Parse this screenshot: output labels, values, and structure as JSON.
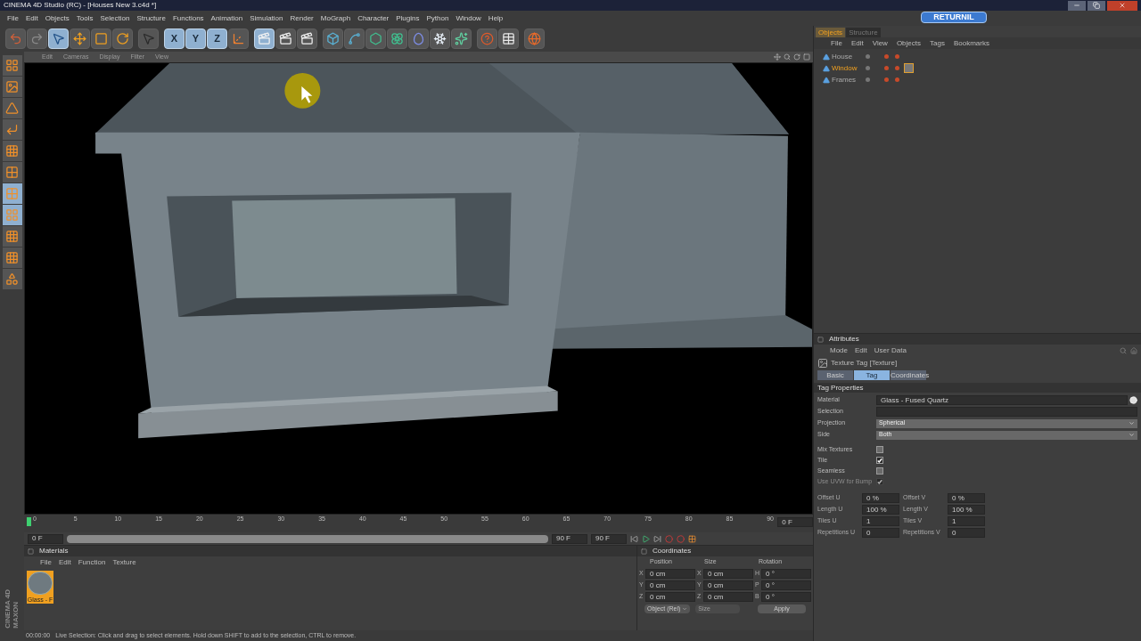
{
  "window": {
    "title": "CINEMA 4D Studio (RC) - [Houses New 3.c4d *]"
  },
  "menu": [
    "File",
    "Edit",
    "Objects",
    "Tools",
    "Selection",
    "Structure",
    "Functions",
    "Animation",
    "Simulation",
    "Render",
    "MoGraph",
    "Character",
    "Plugins",
    "Python",
    "Window",
    "Help"
  ],
  "badge": "RETURNIL",
  "toolbar": [
    [
      {
        "kind": "undo",
        "active": false
      },
      {
        "kind": "redo",
        "active": false
      },
      {
        "kind": "select",
        "active": true
      },
      {
        "kind": "move",
        "active": false
      },
      {
        "kind": "scale",
        "active": false
      },
      {
        "kind": "rotate",
        "active": false
      }
    ],
    [
      {
        "kind": "pointer",
        "active": false
      }
    ],
    [
      {
        "kind": "axis",
        "label": "X",
        "active": true
      },
      {
        "kind": "axis",
        "label": "Y",
        "active": true
      },
      {
        "kind": "axis",
        "label": "Z",
        "active": true
      },
      {
        "kind": "coords",
        "active": false
      }
    ],
    [
      {
        "kind": "render",
        "active": true
      },
      {
        "kind": "render",
        "active": false
      },
      {
        "kind": "render",
        "active": false
      }
    ],
    [
      {
        "kind": "cube",
        "active": false
      },
      {
        "kind": "spline",
        "active": false
      },
      {
        "kind": "nurbs",
        "active": false
      },
      {
        "kind": "array",
        "active": false
      },
      {
        "kind": "deformer",
        "active": false
      },
      {
        "kind": "scene",
        "active": false
      },
      {
        "kind": "particles",
        "active": false
      }
    ],
    [
      {
        "kind": "help",
        "active": false
      },
      {
        "kind": "table",
        "active": false
      }
    ],
    [
      {
        "kind": "globe",
        "active": false
      }
    ]
  ],
  "side_tools": [
    {
      "kind": "layout",
      "active": false
    },
    {
      "kind": "texture",
      "active": false
    },
    {
      "kind": "cone",
      "active": false
    },
    {
      "kind": "axis",
      "active": false
    },
    {
      "kind": "points",
      "active": false
    },
    {
      "kind": "edges",
      "active": false
    },
    {
      "kind": "polygons",
      "active": true
    },
    {
      "kind": "uv",
      "active": true
    },
    {
      "kind": "checker",
      "active": false
    },
    {
      "kind": "uvpoints",
      "active": false
    },
    {
      "kind": "shapes",
      "active": false
    }
  ],
  "logo": [
    "MAXON",
    "CINEMA 4D"
  ],
  "viewport": {
    "menu": [
      "Edit",
      "Cameras",
      "Display",
      "Filter",
      "View"
    ]
  },
  "timeline": {
    "ticks": [
      "0",
      "5",
      "10",
      "15",
      "20",
      "25",
      "30",
      "35",
      "40",
      "45",
      "50",
      "55",
      "60",
      "65",
      "70",
      "75",
      "80",
      "85",
      "90"
    ],
    "current": "0 F",
    "start": "0 F",
    "end": "90 F",
    "range_end": "90 F",
    "level": 1
  },
  "materials": {
    "title": "Materials",
    "menu": [
      "File",
      "Edit",
      "Function",
      "Texture"
    ],
    "items": [
      {
        "label": "Glass - F",
        "selected": true
      }
    ]
  },
  "coordinates": {
    "title": "Coordinates",
    "columns": [
      "Position",
      "Size",
      "Rotation"
    ],
    "rows": [
      [
        {
          "axis": "X",
          "value": "0 cm"
        },
        {
          "axis": "X",
          "value": "0 cm"
        },
        {
          "axis": "H",
          "value": "0 °"
        }
      ],
      [
        {
          "axis": "Y",
          "value": "0 cm"
        },
        {
          "axis": "Y",
          "value": "0 cm"
        },
        {
          "axis": "P",
          "value": "0 °"
        }
      ],
      [
        {
          "axis": "Z",
          "value": "0 cm"
        },
        {
          "axis": "Z",
          "value": "0 cm"
        },
        {
          "axis": "B",
          "value": "0 °"
        }
      ]
    ],
    "mode": "Object (Rel)",
    "size_mode": "Size",
    "apply": "Apply"
  },
  "status_bar": {
    "time": "00:00:00",
    "message": "Live Selection: Click and drag to select elements. Hold down SHIFT to add to the selection, CTRL to remove."
  },
  "objects_panel": {
    "tabs": [
      {
        "label": "Objects",
        "selected": true
      },
      {
        "label": "Structure",
        "selected": false
      }
    ],
    "menu": [
      "File",
      "Edit",
      "View",
      "Objects",
      "Tags",
      "Bookmarks"
    ],
    "items": [
      {
        "name": "House",
        "selected": false,
        "has_tag": false
      },
      {
        "name": "Window",
        "selected": true,
        "has_tag": true
      },
      {
        "name": "Frames",
        "selected": false,
        "has_tag": false
      }
    ]
  },
  "attributes": {
    "title": "Attributes",
    "menu": [
      "Mode",
      "Edit",
      "User Data"
    ],
    "object": "Texture Tag [Texture]",
    "tabs": [
      {
        "label": "Basic",
        "selected": false
      },
      {
        "label": "Tag",
        "selected": true
      },
      {
        "label": "Coordinates",
        "selected": false
      }
    ],
    "section": "Tag Properties",
    "fields": [
      {
        "kind": "link",
        "label": "Material",
        "value": "Glass - Fused Quartz"
      },
      {
        "kind": "text",
        "label": "Selection"
      },
      {
        "kind": "select",
        "label": "Projection",
        "value": "Spherical"
      },
      {
        "kind": "select",
        "label": "Side",
        "value": "Both"
      },
      {
        "kind": "checkbox",
        "label": "Mix Textures",
        "checked": false,
        "disabled": false
      },
      {
        "kind": "checkbox",
        "label": "Tile",
        "checked": true,
        "disabled": false
      },
      {
        "kind": "checkbox",
        "label": "Seamless",
        "checked": false,
        "disabled": false
      },
      {
        "kind": "checkbox",
        "label": "Use UVW for Bump",
        "checked": true,
        "disabled": true
      }
    ],
    "pairs": [
      [
        {
          "label": "Offset U",
          "value": "0 %"
        },
        {
          "label": "Offset V",
          "value": "0 %"
        }
      ],
      [
        {
          "label": "Length U",
          "value": "100 %"
        },
        {
          "label": "Length V",
          "value": "100 %"
        }
      ],
      [
        {
          "label": "Tiles U",
          "value": "1"
        },
        {
          "label": "Tiles V",
          "value": "1"
        }
      ],
      [
        {
          "label": "Repetitions U",
          "value": "0"
        },
        {
          "label": "Repetitions V",
          "value": "0"
        }
      ]
    ]
  }
}
